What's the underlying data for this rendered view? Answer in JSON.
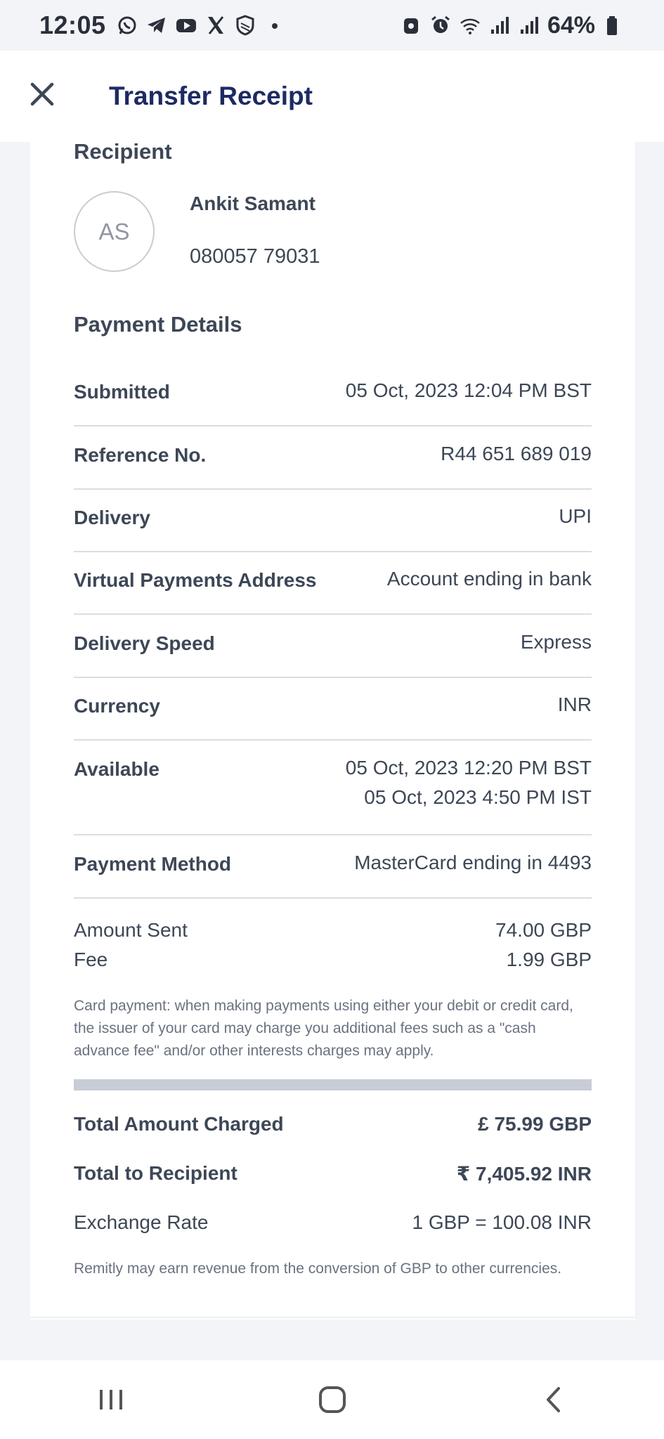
{
  "status_bar": {
    "time": "12:05",
    "battery": "64%",
    "left_icons": [
      "whatsapp-icon",
      "telegram-icon",
      "youtube-icon",
      "x-icon",
      "shield-icon",
      "dot-icon"
    ],
    "right_icons": [
      "lock-icon",
      "alarm-icon",
      "wifi-icon",
      "signal-icon",
      "signal-icon",
      "battery-icon"
    ]
  },
  "header": {
    "title": "Transfer Receipt",
    "close_icon": "close-icon"
  },
  "recipient": {
    "section_title": "Recipient",
    "initials": "AS",
    "name": "Ankit Samant",
    "phone": "080057 79031"
  },
  "payment_details": {
    "section_title": "Payment Details",
    "rows": [
      {
        "label": "Submitted",
        "value": "05 Oct, 2023 12:04 PM BST"
      },
      {
        "label": "Reference No.",
        "value": "R44 651 689 019"
      },
      {
        "label": "Delivery",
        "value": "UPI"
      },
      {
        "label": "Virtual Payments Address",
        "value": "Account ending in bank"
      },
      {
        "label": "Delivery Speed",
        "value": "Express"
      },
      {
        "label": "Currency",
        "value": "INR"
      },
      {
        "label": "Available",
        "value": "05 Oct, 2023 12:20 PM BST",
        "value2": "05 Oct, 2023 4:50 PM IST"
      },
      {
        "label": "Payment Method",
        "value": "MasterCard ending in 4493"
      }
    ]
  },
  "amounts": {
    "amount_sent_label": "Amount Sent",
    "amount_sent_value": "74.00 GBP",
    "fee_label": "Fee",
    "fee_value": "1.99 GBP",
    "card_disclaimer": "Card payment: when making payments using either your debit or credit card, the issuer of your card may charge you additional fees such as a \"cash advance fee\" and/or other interests charges may apply."
  },
  "totals": {
    "total_charged_label": "Total Amount Charged",
    "total_charged_value": "£ 75.99 GBP",
    "total_recipient_label": "Total to Recipient",
    "total_recipient_value": "₹ 7,405.92 INR",
    "exchange_rate_label": "Exchange Rate",
    "exchange_rate_value": "1 GBP = 100.08 INR",
    "revenue_disclaimer": "Remitly may earn revenue from the conversion of GBP to other currencies."
  },
  "nav_bar": {
    "icons": [
      "recent-apps-icon",
      "home-icon",
      "back-icon"
    ]
  },
  "colors": {
    "title_navy": "#1d2a63",
    "text": "#3d4756",
    "background": "#f3f4f8"
  }
}
